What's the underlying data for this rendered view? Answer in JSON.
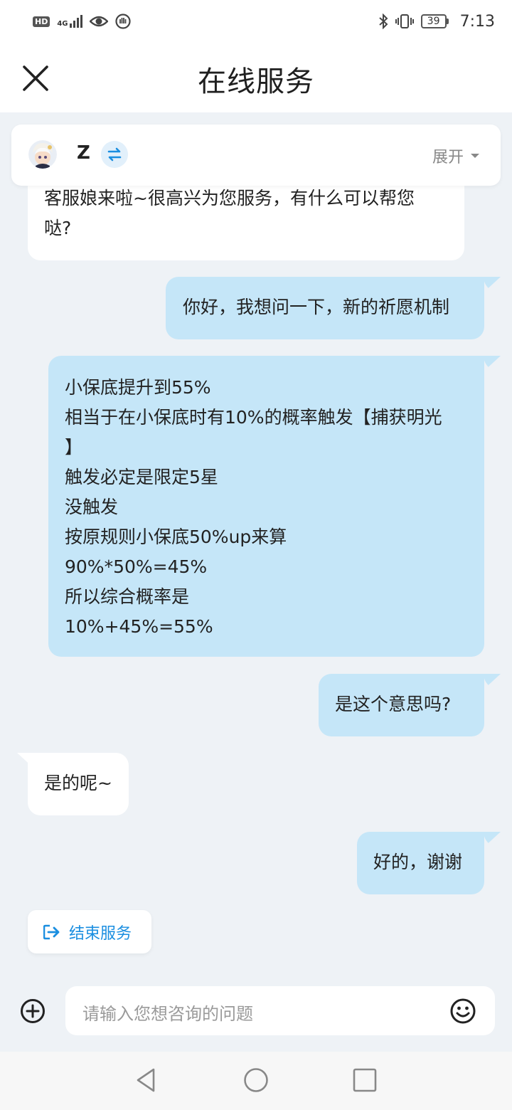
{
  "status_bar": {
    "hd_badge": "HD",
    "network": "4G",
    "battery_level": "39",
    "time": "7:13",
    "icons": [
      "hd-icon",
      "signal-icon",
      "eye-icon",
      "hand-icon",
      "bluetooth-icon",
      "vibrate-icon",
      "battery-icon"
    ]
  },
  "header": {
    "title": "在线服务",
    "close_icon": "close-icon"
  },
  "agent_card": {
    "name": "Z",
    "expand_label": "展开",
    "switch_icon": "swap-icon"
  },
  "messages": [
    {
      "from": "agent",
      "lines": [
        "客服娘来啦~很高兴为您服务，有什么可以帮您",
        "哒?"
      ]
    },
    {
      "from": "user",
      "lines": [
        "你好，我想问一下，新的祈愿机制"
      ]
    },
    {
      "from": "user",
      "lines": [
        "小保底提升到55%",
        "相当于在小保底时有10%的概率触发【捕获明光",
        "】",
        "触发必定是限定5星",
        "没触发",
        "按原规则小保底50%up来算",
        "90%*50%=45%",
        "所以综合概率是",
        "10%+45%=55%"
      ]
    },
    {
      "from": "user",
      "lines": [
        "是这个意思吗?"
      ]
    },
    {
      "from": "agent",
      "lines": [
        "是的呢~"
      ]
    },
    {
      "from": "user",
      "lines": [
        "好的，谢谢"
      ]
    }
  ],
  "end_service": {
    "label": "结束服务",
    "icon": "logout-icon"
  },
  "input": {
    "placeholder": "请输入您想咨询的问题"
  },
  "colors": {
    "accent": "#1a8ee0",
    "user_bubble": "#c5e6f8",
    "agent_bubble": "#ffffff",
    "background": "#eef2f6"
  }
}
